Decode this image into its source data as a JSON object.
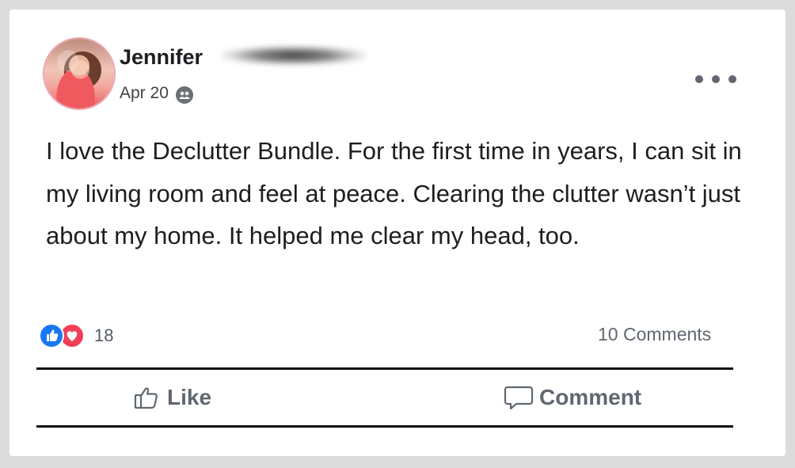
{
  "post": {
    "author": "Jennifer",
    "date": "Apr 20",
    "text": "I love the Declutter Bundle. For the first time in years, I can sit in my living room and feel at peace. Clearing the clutter wasn’t just about my home. It helped me clear my head, too.",
    "reactions": {
      "count": "18",
      "types": [
        "like-icon",
        "love-icon"
      ]
    },
    "comments_label": "10 Comments"
  },
  "actions": {
    "like_label": "Like",
    "comment_label": "Comment"
  },
  "icons": {
    "privacy": "friends-icon",
    "more": "more-options-icon",
    "like_action": "thumbs-up-outline-icon",
    "comment_action": "speech-bubble-icon"
  },
  "colors": {
    "like_blue": "#1877f2",
    "love_red": "#f33e58",
    "secondary_text": "#606770",
    "primary_text": "#1c1e21"
  }
}
